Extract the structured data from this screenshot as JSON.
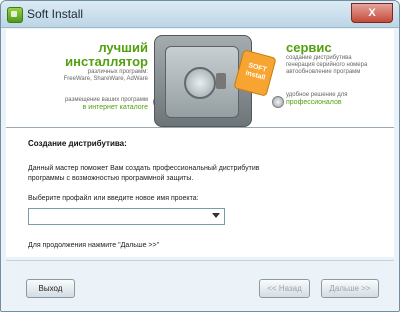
{
  "window": {
    "title": "Soft Install",
    "close_label": "X"
  },
  "banner": {
    "left_heading_1": "лучший",
    "left_heading_2": "инсталлятор",
    "left_sub_1": "различных программ:",
    "left_sub_2": "FreeWare, ShareWare, AdWare",
    "left_bottom_1": "размещение ваших программ",
    "left_bottom_2": "в интернет каталоге",
    "tag_text_1": "SOFT",
    "tag_text_2": "install",
    "right_heading": "сервис",
    "right_items": [
      "создание дистрибутива",
      "генерация серийного номера",
      "автообновление программ"
    ],
    "right_bottom_1": "удобное решение для",
    "right_bottom_2": "профессионалов"
  },
  "content": {
    "title": "Создание дистрибутива:",
    "description": "Данный мастер поможет Вам создать профессиональный дистрибутив программы с возможностью программной защиты.",
    "select_label": "Выберите профайл или введите новое имя проекта:",
    "select_value": "",
    "continue_note": "Для продолжения нажмите \"Дальше >>\""
  },
  "buttons": {
    "exit": "Выход",
    "back": "<< Назад",
    "next": "Дальше >>"
  },
  "colors": {
    "accent_green": "#53a010",
    "tag_orange": "#f7a431"
  }
}
